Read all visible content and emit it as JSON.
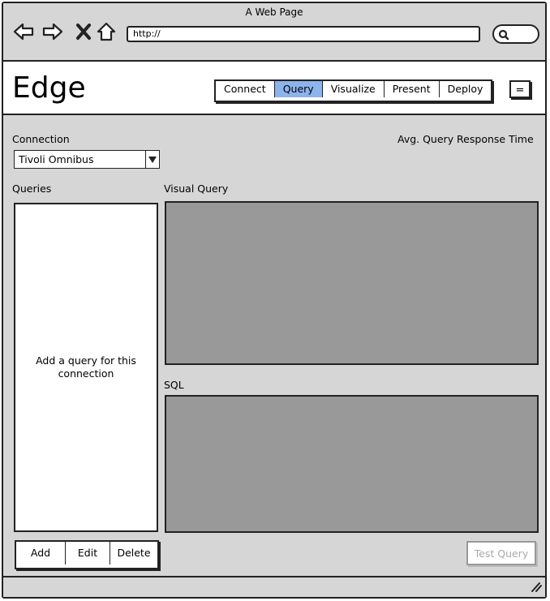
{
  "browser": {
    "page_title": "A Web Page",
    "url": "http://"
  },
  "app": {
    "title": "Edge",
    "tabs": [
      {
        "label": "Connect",
        "active": false
      },
      {
        "label": "Query",
        "active": true
      },
      {
        "label": "Visualize",
        "active": false
      },
      {
        "label": "Present",
        "active": false
      },
      {
        "label": "Deploy",
        "active": false
      }
    ],
    "menu_label": "="
  },
  "connection": {
    "label": "Connection",
    "selected": "Tivoli Omnibus"
  },
  "stats": {
    "label": "Avg. Query Response Time"
  },
  "queries": {
    "label": "Queries",
    "empty_message": "Add a query for this connection",
    "buttons": {
      "add": "Add",
      "edit": "Edit",
      "delete": "Delete"
    }
  },
  "visual_query": {
    "label": "Visual Query"
  },
  "sql": {
    "label": "SQL"
  },
  "test_query_label": "Test Query",
  "colors": {
    "active_tab": "#8cb4ec",
    "panel_fill": "#999999",
    "background": "#d6d6d6"
  }
}
